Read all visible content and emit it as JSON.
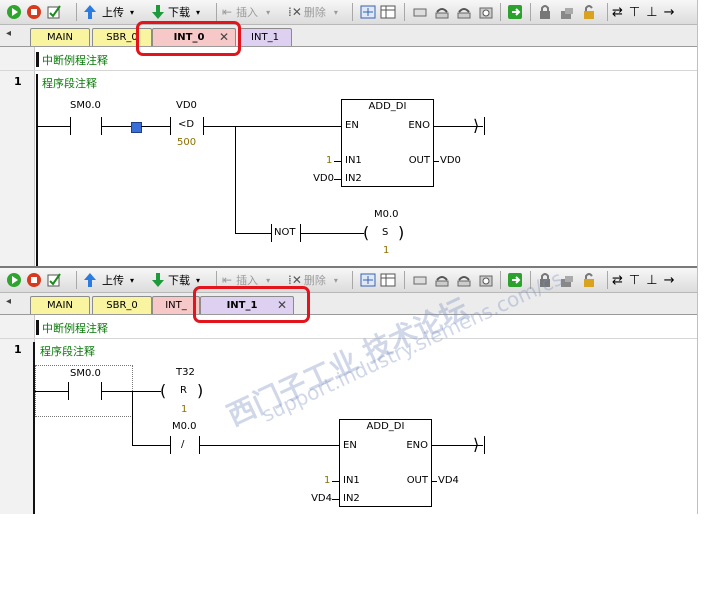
{
  "toolbar": {
    "upload_label": "上传",
    "download_label": "下载",
    "insert_label": "插入",
    "delete_label": "删除"
  },
  "top_pane": {
    "tabs": [
      {
        "label": "MAIN",
        "color": "#f8f4a0"
      },
      {
        "label": "SBR_0",
        "color": "#f8f4a0"
      },
      {
        "label": "INT_0",
        "color": "#f6c8c8",
        "active": true
      },
      {
        "label": "INT_1",
        "color": "#ddd0f0"
      }
    ],
    "subroutine_comment": "中断例程注释",
    "network": {
      "number": "1",
      "comment": "程序段注释",
      "contact_address": "SM0.0",
      "compare_address": "VD0",
      "compare_op": "<D",
      "compare_value": "500",
      "box_title": "ADD_DI",
      "pin_en": "EN",
      "pin_eno": "ENO",
      "pin_in1": "IN1",
      "pin_in2": "IN2",
      "pin_out": "OUT",
      "in1_value": "1",
      "in2_value": "VD0",
      "out_value": "VD0",
      "not_label": "NOT",
      "coil_address": "M0.0",
      "coil_type": "S",
      "coil_value": "1"
    }
  },
  "bottom_pane": {
    "tabs": [
      {
        "label": "MAIN",
        "color": "#f8f4a0"
      },
      {
        "label": "SBR_0",
        "color": "#f8f4a0"
      },
      {
        "label": "INT_",
        "color": "#f6c8c8"
      },
      {
        "label": "INT_1",
        "color": "#ddd0f0",
        "active": true
      }
    ],
    "subroutine_comment": "中断例程注释",
    "network": {
      "number": "1",
      "comment": "程序段注释",
      "contact_address": "SM0.0",
      "reset_address": "T32",
      "reset_type": "R",
      "reset_value": "1",
      "nc_address": "M0.0",
      "nc_symbol": "/",
      "box_title": "ADD_DI",
      "pin_en": "EN",
      "pin_eno": "ENO",
      "pin_in1": "IN1",
      "pin_in2": "IN2",
      "pin_out": "OUT",
      "in1_value": "1",
      "in2_value": "VD4",
      "out_value": "VD4"
    }
  },
  "watermark": {
    "cn": "西门子工业 技术论坛",
    "url": "support.industry.siemens.com/cs"
  },
  "colors": {
    "highlight": "#e3141b",
    "comment_green": "#0a7a0a",
    "value_gold": "#8a7000"
  }
}
